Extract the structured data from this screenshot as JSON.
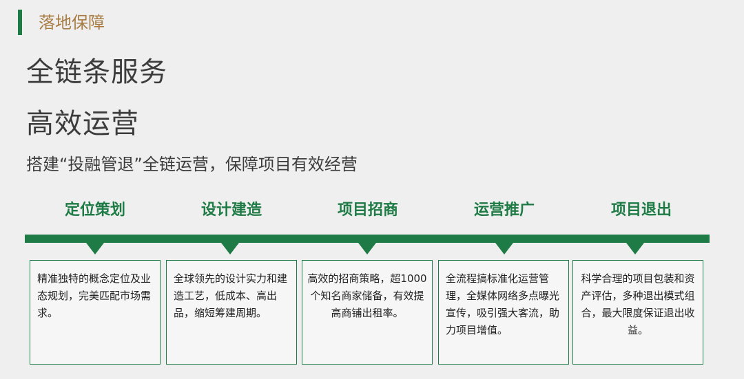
{
  "section_label": "落地保障",
  "headline": {
    "line1": "全链条服务",
    "line2": "高效运营"
  },
  "subtitle": "搭建“投融管退”全链运营，保障项目有效经营",
  "stages": [
    {
      "title": "定位策划",
      "description": "精准独特的概念定位及业态规划，完美匹配市场需求。"
    },
    {
      "title": "设计建造",
      "description": "全球领先的设计实力和建造工艺，低成本、高出品，缩短筹建周期。"
    },
    {
      "title": "项目招商",
      "description": "高效的招商策略，超1000个知名商家储备，有效提高商铺出租率。"
    },
    {
      "title": "运营推广",
      "description": "全流程搞标准化运营管理，全媒体网络多点曝光宣传，吸引强大客流，助力项目增值。"
    },
    {
      "title": "项目退出",
      "description": "科学合理的项目包装和资产评估，多种退出模式组合，最大限度保证退出收益。"
    }
  ],
  "colors": {
    "accent_green": "#1e7b45",
    "label_gold": "#a87d45",
    "heading_text": "#3c3c3c",
    "background": "#efefef"
  }
}
